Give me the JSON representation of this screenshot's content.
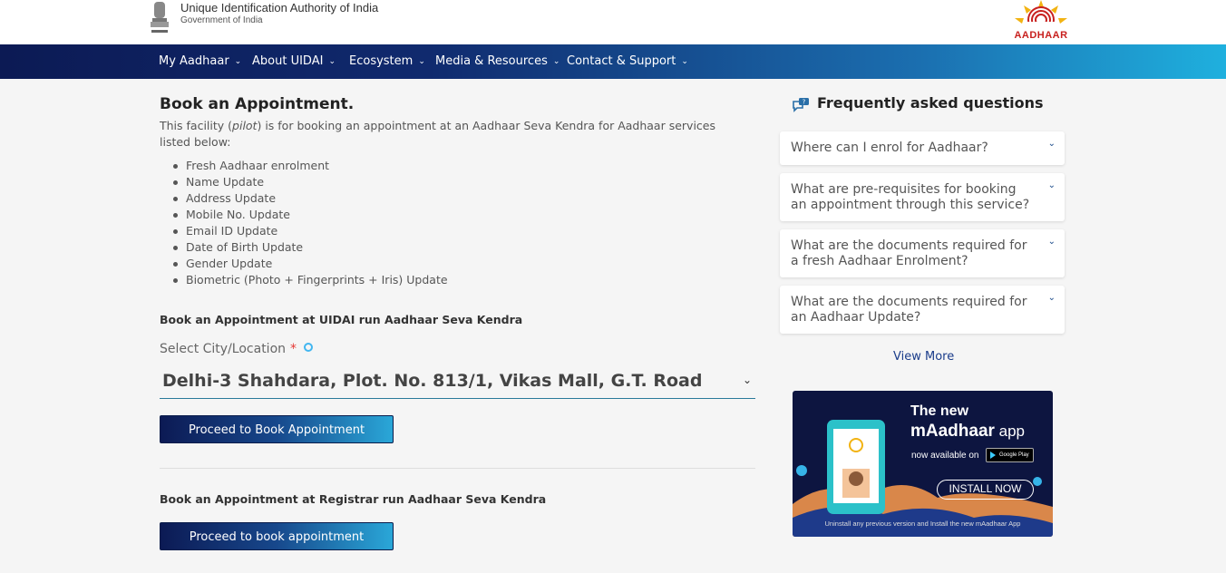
{
  "header": {
    "org_title": "Unique Identification Authority of India",
    "org_subtitle": "Government of India",
    "emblem_icon": "national-emblem-icon",
    "logo_text": "AADHAAR"
  },
  "nav": {
    "items": [
      {
        "label": "My Aadhaar"
      },
      {
        "label": "About UIDAI"
      },
      {
        "label": "Ecosystem"
      },
      {
        "label": "Media & Resources"
      },
      {
        "label": "Contact & Support"
      }
    ]
  },
  "main": {
    "title": "Book an Appointment.",
    "intro_before": "This facility (",
    "intro_italic": "pilot",
    "intro_after": ") is for booking an appointment at an Aadhaar Seva Kendra for Aadhaar services listed below:",
    "services": [
      "Fresh Aadhaar enrolment",
      "Name Update",
      "Address Update",
      "Mobile No. Update",
      "Email ID Update",
      "Date of Birth Update",
      "Gender Update",
      "Biometric (Photo + Fingerprints + Iris) Update"
    ],
    "uidai_section_title": "Book an Appointment at UIDAI run Aadhaar Seva Kendra",
    "city_label": "Select City/Location",
    "required_mark": "*",
    "city_value": "Delhi-3 Shahdara, Plot. No. 813/1, Vikas Mall, G.T. Road",
    "proceed_uidai_label": "Proceed to Book Appointment",
    "registrar_section_title": "Book an Appointment at Registrar run Aadhaar Seva Kendra",
    "proceed_registrar_label": "Proceed to book appointment"
  },
  "faq": {
    "title": "Frequently asked questions",
    "questions": [
      "Where can I enrol for Aadhaar?",
      "What are pre-requisites for booking an appointment through this service?",
      "What are the documents required for a fresh Aadhaar Enrolment?",
      "What are the documents required for an Aadhaar Update?"
    ],
    "view_more": "View More"
  },
  "banner": {
    "line1": "The new",
    "app_name_bold": "mAadhaar",
    "app_name_suffix": " app",
    "available": "now available on",
    "store": "Google Play",
    "install": "INSTALL NOW",
    "footer": "Uninstall any previous version and Install the new mAadhaar App"
  },
  "colors": {
    "nav_start": "#0c1a54",
    "nav_end": "#1fb0de",
    "required": "#e53935",
    "link": "#1a3c8a"
  }
}
